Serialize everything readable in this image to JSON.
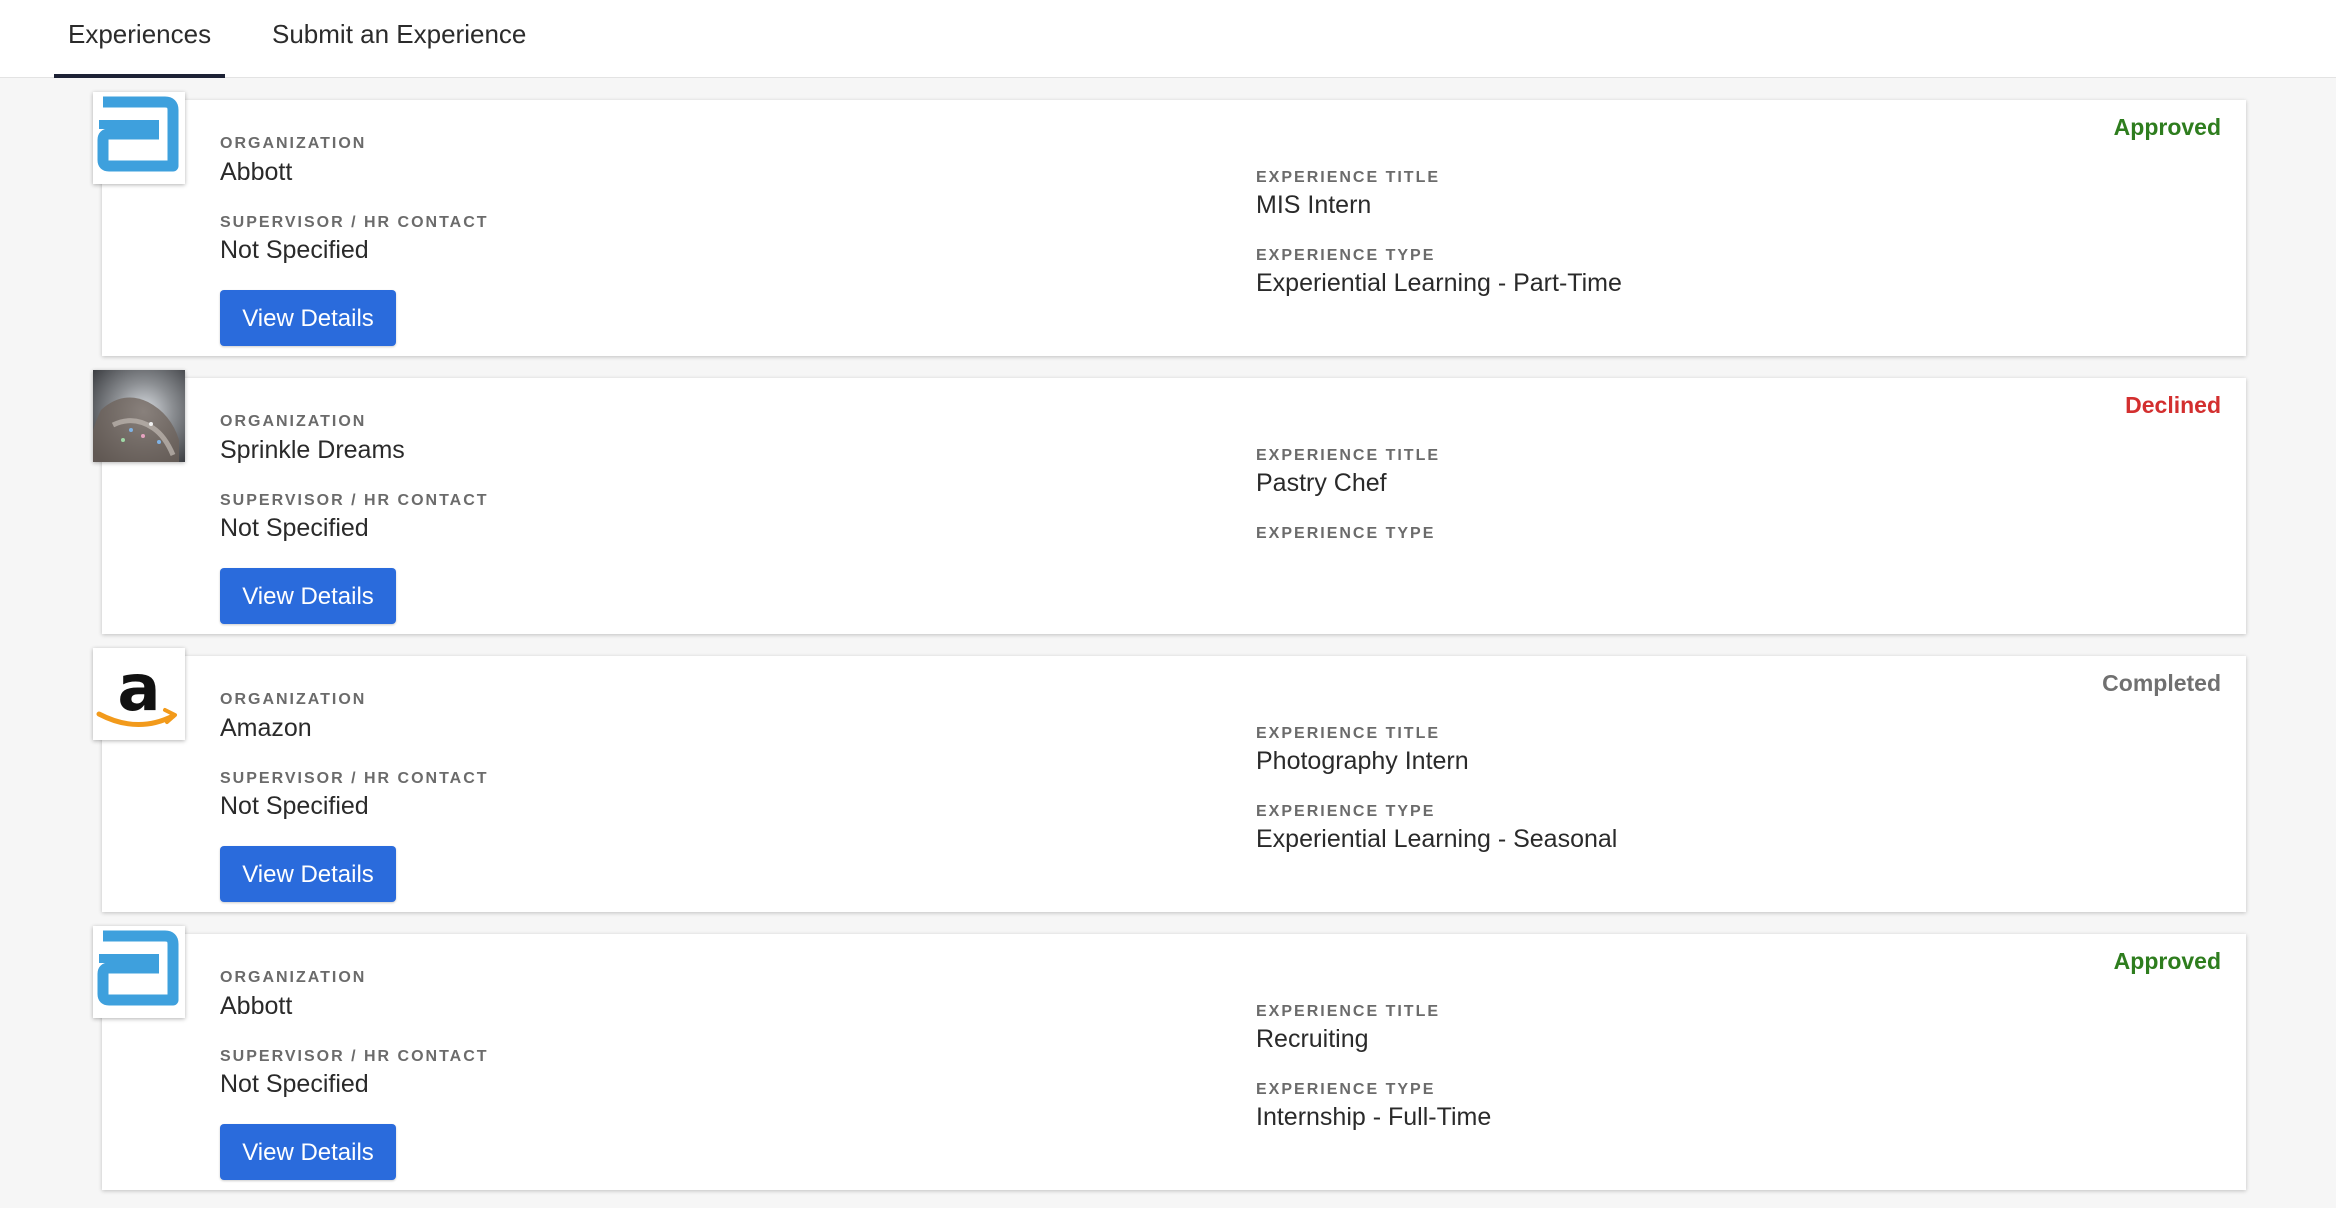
{
  "tabs": {
    "experiences": "Experiences",
    "submit": "Submit an Experience"
  },
  "labels": {
    "organization": "Organization",
    "supervisor": "Supervisor / HR Contact",
    "experience_title": "Experience Title",
    "experience_type": "Experience Type",
    "view_details": "View Details"
  },
  "status_colors": {
    "Approved": "#2e7d1e",
    "Declined": "#d32f2f",
    "Completed": "#707070"
  },
  "experiences": [
    {
      "logo": "abbott-logo",
      "organization": "Abbott",
      "supervisor": "Not Specified",
      "title": "MIS Intern",
      "type": "Experiential Learning - Part-Time",
      "status": "Approved"
    },
    {
      "logo": "pastry-photo",
      "organization": "Sprinkle Dreams",
      "supervisor": "Not Specified",
      "title": "Pastry Chef",
      "type": "",
      "status": "Declined"
    },
    {
      "logo": "amazon-logo",
      "organization": "Amazon",
      "supervisor": "Not Specified",
      "title": "Photography Intern",
      "type": "Experiential Learning - Seasonal",
      "status": "Completed"
    },
    {
      "logo": "abbott-logo",
      "organization": "Abbott",
      "supervisor": "Not Specified",
      "title": "Recruiting",
      "type": "Internship - Full-Time",
      "status": "Approved"
    }
  ]
}
